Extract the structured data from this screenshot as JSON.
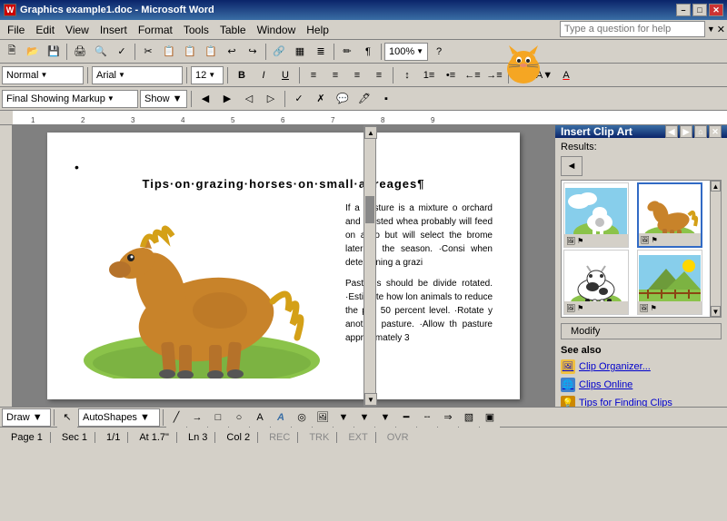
{
  "titlebar": {
    "title": "Graphics example1.doc - Microsoft Word",
    "icon": "W",
    "min": "–",
    "max": "□",
    "close": "✕"
  },
  "menubar": {
    "items": [
      "File",
      "Edit",
      "View",
      "Insert",
      "Format",
      "Tools",
      "Table",
      "Window",
      "Help"
    ]
  },
  "search": {
    "placeholder": "Type a question for help",
    "arrow": "▼"
  },
  "toolbar1": {
    "buttons": [
      "🗎",
      "🗁",
      "💾",
      "🖨",
      "🔍",
      "✂",
      "📋",
      "📋",
      "↩",
      "↪",
      "🔗",
      "📊",
      "≣",
      "∑",
      "A",
      "?"
    ],
    "zoom": "100%"
  },
  "fmt_toolbar": {
    "style": "Normal",
    "font": "Arial",
    "size": "12",
    "bold": "B",
    "italic": "I",
    "underline": "U",
    "align_left": "≡",
    "align_center": "≡",
    "align_right": "≡",
    "justify": "≡",
    "indent_dec": "←",
    "indent_inc": "→",
    "numbering": "≔",
    "bullets": "•≡",
    "highlight": "A▼",
    "font_color": "A▼"
  },
  "review_toolbar": {
    "mode": "Final Showing Markup",
    "show": "Show ▼",
    "btns": [
      "◀",
      "◀",
      "▶",
      "▶",
      "📝",
      "🗑",
      "🔒",
      ""
    ]
  },
  "doc": {
    "bullet": "•",
    "title": "Tips·on·grazing·horses·on·small·acreages¶",
    "para1": "If a pasture is a mixture of orchid and crested whea probably will feed on all o but will select the brome later in the season. Consi when determining a grazi",
    "para2": "Pastures should be divide rotated. Estimate how lon animals to reduce the pas 50 percent level. Rotate y another pasture. Allow th pasture approximately 3",
    "horse_desc": "brown horse grazing illustration"
  },
  "clip_art": {
    "title": "Insert Clip Art",
    "results_label": "Results:",
    "thumbs": [
      {
        "id": 1,
        "desc": "blue sky with cow"
      },
      {
        "id": 2,
        "desc": "brown horse grazing"
      },
      {
        "id": 3,
        "desc": "black and white cow"
      },
      {
        "id": 4,
        "desc": "pasture landscape"
      }
    ],
    "modify_btn": "Modify",
    "see_also_label": "See also",
    "see_also_items": [
      {
        "label": "Clip Organizer...",
        "icon": "🖼"
      },
      {
        "label": "Clips Online",
        "icon": "🌐"
      },
      {
        "label": "Tips for Finding Clips",
        "icon": "💡"
      }
    ]
  },
  "statusbar": {
    "page": "Page 1",
    "sec": "Sec 1",
    "pages": "1/1",
    "at": "At 1.7\"",
    "ln": "Ln 3",
    "col": "Col 2",
    "rec": "REC",
    "trk": "TRK",
    "ext": "EXT",
    "ovr": "OVR"
  },
  "draw_toolbar": {
    "draw_btn": "Draw ▼",
    "shapes_btn": "AutoShapes ▼"
  }
}
